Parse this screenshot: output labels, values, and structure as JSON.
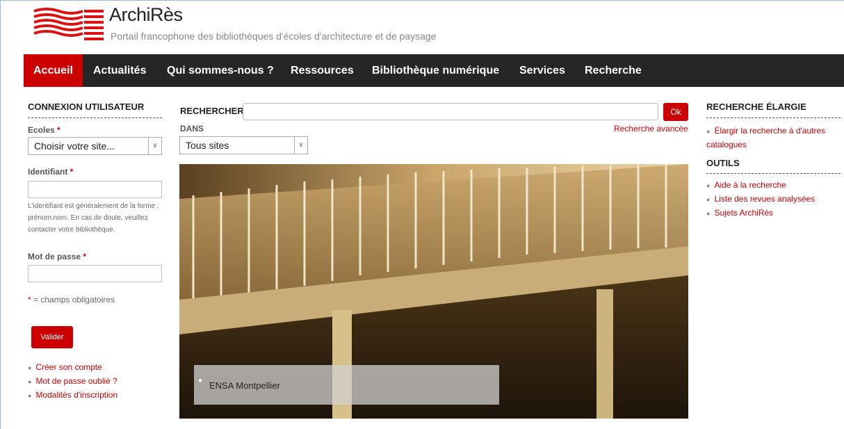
{
  "header": {
    "site_title": "ArchiRès",
    "site_subtitle": "Portail francophone des bibliothèques d'écoles d'architecture et de paysage",
    "logo_icon": "archires-logo-icon"
  },
  "nav": {
    "items": [
      {
        "label": "Accueil",
        "active": true
      },
      {
        "label": "Actualités",
        "active": false
      },
      {
        "label": "Qui sommes-nous ?",
        "active": false
      },
      {
        "label": "Ressources",
        "active": false
      },
      {
        "label": "Bibliothèque numérique",
        "active": false
      },
      {
        "label": "Services",
        "active": false
      },
      {
        "label": "Recherche",
        "active": false
      }
    ]
  },
  "login": {
    "title": "CONNEXION UTILISATEUR",
    "ecoles_label": "Ecoles",
    "ecoles_value": "Choisir votre site...",
    "identifiant_label": "Identifiant",
    "identifiant_help": "L'identifiant est généralement de la forme : prénom.nom. En cas de doute, veuillez contacter votre bibliothèque.",
    "password_label": "Mot de passe",
    "required_star": "*",
    "required_note": "= champs obligatoires",
    "submit_label": "Valider",
    "links": [
      "Créer son compte",
      "Mot de passe oublié ?",
      "Modalités d'inscription"
    ]
  },
  "search": {
    "label": "RECHERCHER",
    "ok_label": "Ok",
    "dans_label": "DANS",
    "scope_value": "Tous sites",
    "advanced_link": "Recherche avancée"
  },
  "slideshow": {
    "caption": "ENSA Montpellier"
  },
  "right": {
    "recherche_title": "RECHERCHE ÉLARGIE",
    "recherche_links": [
      "Élargir la recherche à d'autres catalogues"
    ],
    "outils_title": "OUTILS",
    "outils_links": [
      "Aide à la recherche",
      "Liste des revues analysées",
      "Sujets ArchiRès"
    ]
  },
  "colors": {
    "accent": "#cc0000",
    "nav_bg": "#262626"
  }
}
